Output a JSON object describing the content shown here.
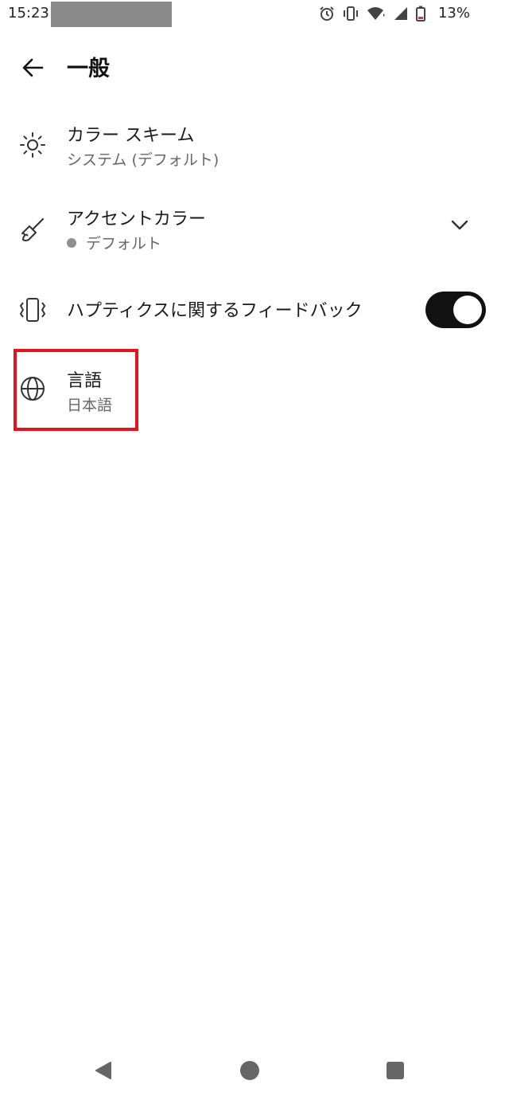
{
  "status_bar": {
    "time": "15:23",
    "battery_percent": "13%",
    "icons": [
      "alarm-icon",
      "vibrate-icon",
      "wifi-icon",
      "signal-icon",
      "battery-icon"
    ]
  },
  "header": {
    "title": "一般",
    "back_icon": "back-arrow-icon"
  },
  "settings": {
    "color_scheme": {
      "icon": "sun-icon",
      "title": "カラー スキーム",
      "subtitle": "システム (デフォルト)"
    },
    "accent_color": {
      "icon": "paintbrush-icon",
      "title": "アクセントカラー",
      "subtitle": "デフォルト",
      "dot_color": "#8f8f8f",
      "expand_icon": "chevron-down-icon"
    },
    "haptics": {
      "icon": "vibration-icon",
      "title": "ハプティクスに関するフィードバック",
      "enabled": true
    },
    "language": {
      "icon": "globe-icon",
      "title": "言語",
      "subtitle": "日本語"
    }
  },
  "highlight": {
    "color": "#e3141c",
    "target": "language"
  },
  "nav_bar": {
    "back_icon": "triangle-back-icon",
    "home_icon": "circle-home-icon",
    "recents_icon": "square-recents-icon"
  }
}
